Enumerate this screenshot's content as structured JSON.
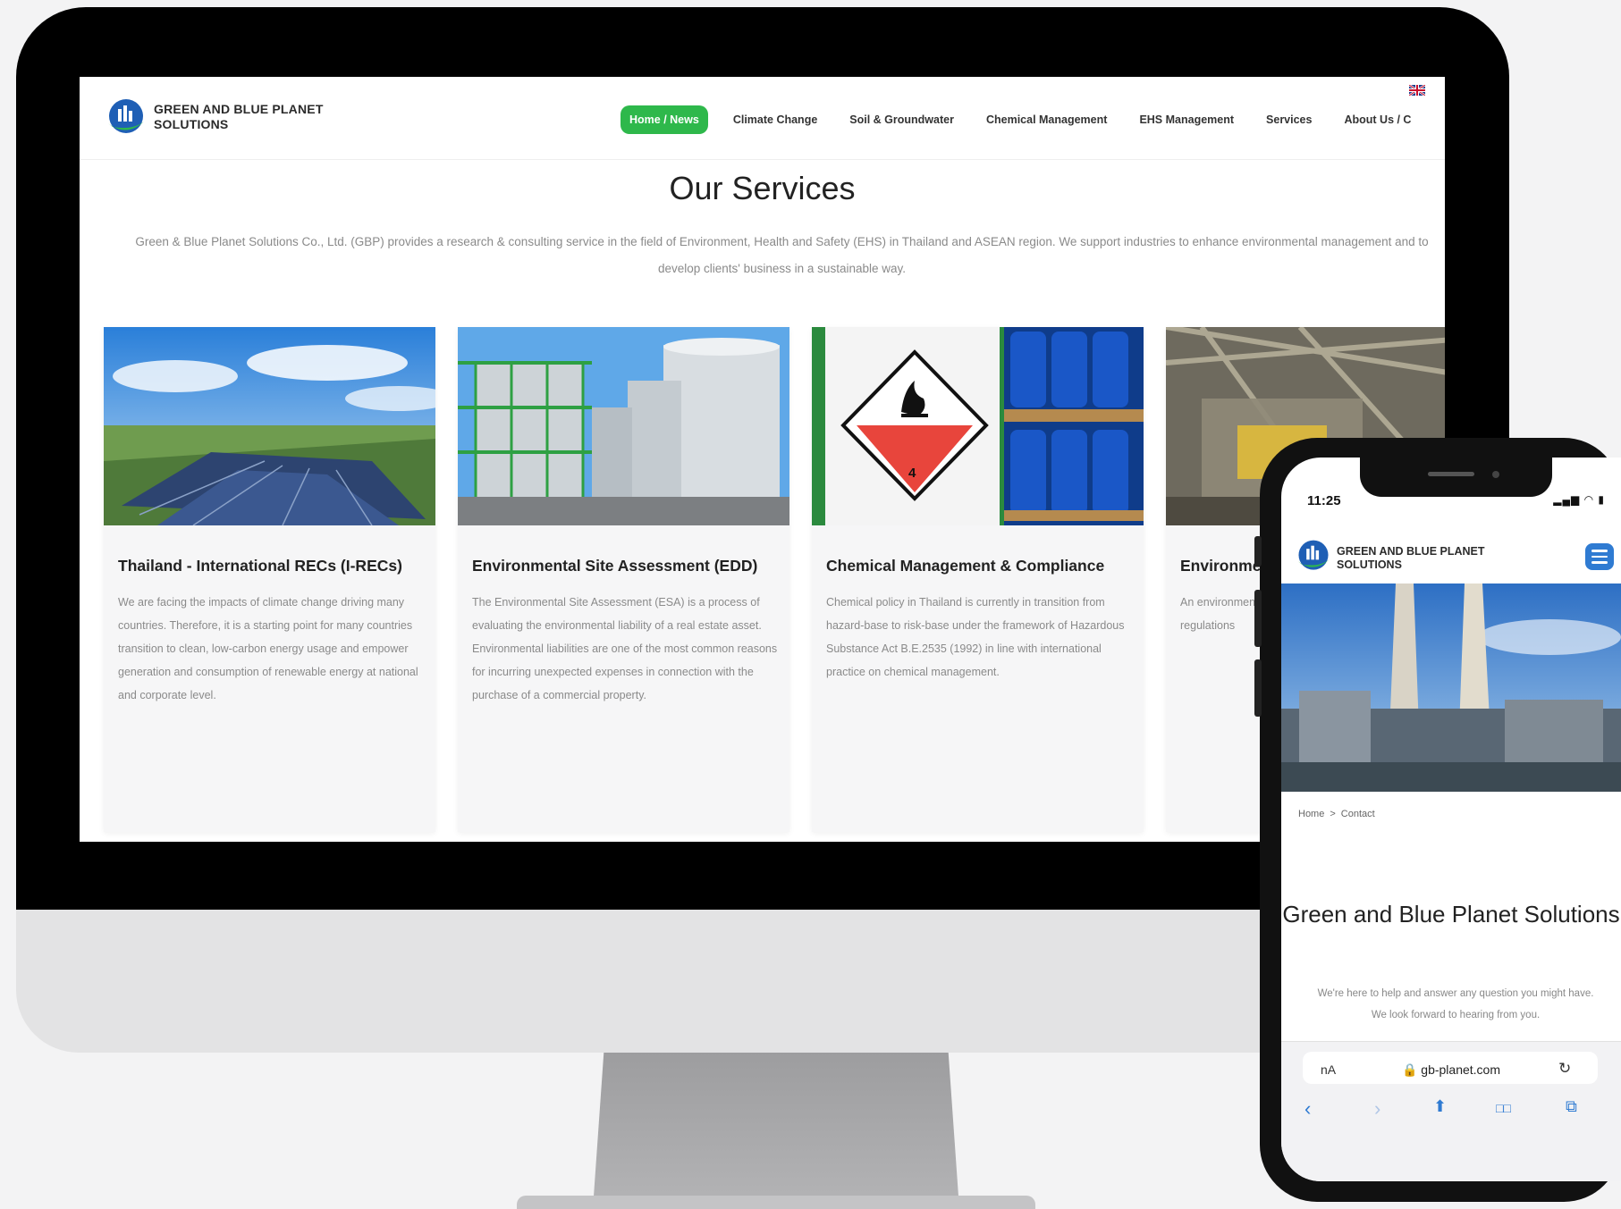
{
  "desktop": {
    "brand_line1": "GREEN AND BLUE PLANET",
    "brand_line2": "SOLUTIONS",
    "nav": [
      {
        "label": "Home / News"
      },
      {
        "label": "Climate Change"
      },
      {
        "label": "Soil & Groundwater"
      },
      {
        "label": "Chemical Management"
      },
      {
        "label": "EHS Management"
      },
      {
        "label": "Services"
      },
      {
        "label": "About Us / C"
      }
    ],
    "page_title": "Our Services",
    "intro": "Green & Blue Planet Solutions Co., Ltd. (GBP) provides a research & consulting service in the field of Environment, Health and Safety (EHS) in Thailand and ASEAN region. We support industries to enhance environmental management and to develop clients' business in a sustainable way.",
    "cards": [
      {
        "title": "Thailand - International RECs (I-RECs)",
        "text": "We are facing the impacts of climate change driving many countries. Therefore, it is a starting point for many countries transition to clean, low-carbon energy usage and empower generation and consumption of renewable energy at national and corporate level."
      },
      {
        "title": "Environmental Site Assessment (EDD)",
        "text": "The Environmental Site Assessment (ESA) is a process of evaluating the environmental liability of a real estate asset. Environmental liabilities are one of the most common reasons for incurring unexpected expenses in connection with the purchase of a commercial property."
      },
      {
        "title": "Chemical Management & Compliance",
        "text": "Chemical policy in Thailand is currently in transition from hazard-base to risk-base under the framework of Hazardous Substance Act B.E.2535 (1992) in line with international practice on chemical management."
      },
      {
        "title": "Environmental Compliance",
        "text": "An environmental compliance audit is whether a world regulations"
      }
    ],
    "hazard_label_number": "4"
  },
  "mobile": {
    "time": "11:25",
    "status_icons": "▂▄▆ ◠ ▮",
    "brand_line1": "GREEN AND BLUE PLANET",
    "brand_line2": "SOLUTIONS",
    "breadcrumb_home": "Home",
    "breadcrumb_sep": ">",
    "breadcrumb_current": "Contact",
    "title": "Green and Blue Planet Solutions",
    "text_line1": "We're here to help and answer any question you might have.",
    "text_line2": "We look forward to hearing from you.",
    "url_aa": "nA",
    "url": "🔒 gb-planet.com",
    "reload": "↻",
    "toolbar": {
      "back": "‹",
      "forward": "›",
      "share": "⬆",
      "bookmarks": "□□",
      "tabs": "⧉"
    }
  },
  "colors": {
    "accent_green": "#2eb84b",
    "accent_blue": "#2f7bd2",
    "hazard_red": "#e8453c",
    "drum_blue": "#1a57c7"
  }
}
